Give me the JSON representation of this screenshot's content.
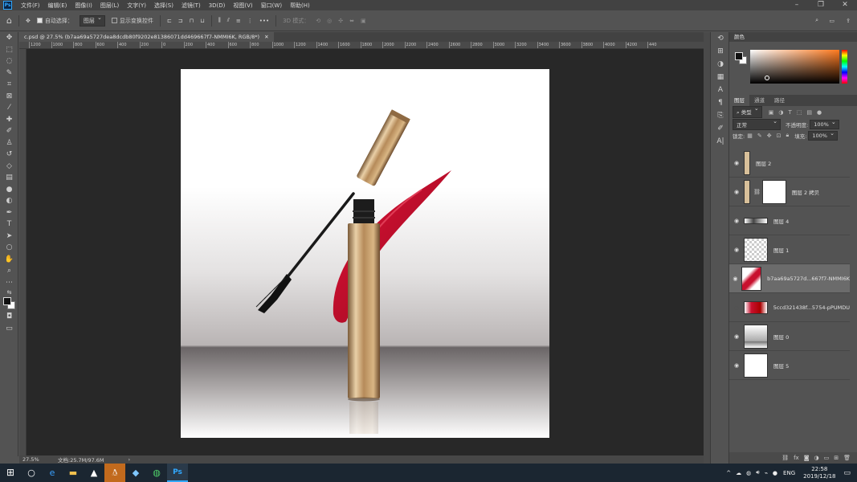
{
  "menu": [
    "文件(F)",
    "编辑(E)",
    "图像(I)",
    "图层(L)",
    "文字(Y)",
    "选择(S)",
    "滤镜(T)",
    "3D(D)",
    "视图(V)",
    "窗口(W)",
    "帮助(H)"
  ],
  "app_logo": "Ps",
  "options": {
    "auto_select_label": "自动选择：",
    "auto_select_value": "图层",
    "show_transform_label": "显示变换控件",
    "more": "•••",
    "mode_3d": "3D 模式："
  },
  "document": {
    "tab_title": "c.psd @ 27.5% (b7aa69a5727dea8dcdb80f9202e81386071dd469667f7-NMMI6K, RGB/8*)",
    "ruler_ticks": [
      "1200",
      "1000",
      "800",
      "600",
      "400",
      "200",
      "0",
      "200",
      "400",
      "600",
      "800",
      "1000",
      "1200",
      "1400",
      "1600",
      "1800",
      "2000",
      "2200",
      "2400",
      "2600",
      "2800",
      "3000",
      "3200",
      "3400",
      "3600",
      "3800",
      "4000",
      "4200",
      "440"
    ],
    "zoom": "27.5%",
    "doc_size": "文档:25.7M/97.6M"
  },
  "color_panel": {
    "title": "颜色"
  },
  "layers_panel": {
    "tabs": [
      "图层",
      "通道",
      "路径"
    ],
    "filter_kind": "类型",
    "blend_mode": "正常",
    "opacity_label": "不透明度:",
    "opacity_value": "100%",
    "lock_label": "锁定:",
    "fill_label": "填充:",
    "fill_value": "100%",
    "layers": [
      {
        "name": "图层 2",
        "visible": true
      },
      {
        "name": "图层 2 拷贝",
        "visible": true
      },
      {
        "name": "图层 4",
        "visible": true
      },
      {
        "name": "图层 1",
        "visible": true
      },
      {
        "name": "b7aa69a5727d...667f7-NMMI6K",
        "visible": true,
        "selected": true
      },
      {
        "name": "5ccd321438f...5754-pPUMDU",
        "visible": false
      },
      {
        "name": "图层 0",
        "visible": true
      },
      {
        "name": "图层 5",
        "visible": true
      }
    ],
    "footer_icons": [
      "link-icon",
      "fx-icon",
      "mask-icon",
      "adjustment-icon",
      "group-icon",
      "new-layer-icon",
      "trash-icon"
    ]
  },
  "taskbar": {
    "lang": "ENG",
    "time": "22:58",
    "date": "2019/12/18"
  },
  "colors": {
    "accent": "#31a8ff",
    "lipstick": "#c8102e",
    "gold": "#b98f5e"
  }
}
